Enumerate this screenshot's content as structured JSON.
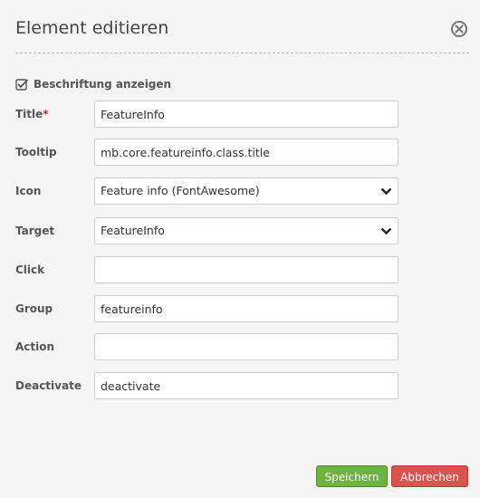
{
  "dialog": {
    "title": "Element editieren",
    "close_icon": "close-circle-icon"
  },
  "show_label": {
    "label": "Beschriftung anzeigen",
    "checked": true
  },
  "fields": {
    "title": {
      "label": "Title",
      "required_mark": "*",
      "value": "FeatureInfo"
    },
    "tooltip": {
      "label": "Tooltip",
      "value": "mb.core.featureinfo.class.title"
    },
    "icon": {
      "label": "Icon",
      "value": "Feature info (FontAwesome)"
    },
    "target": {
      "label": "Target",
      "value": "FeatureInfo"
    },
    "click": {
      "label": "Click",
      "value": ""
    },
    "group": {
      "label": "Group",
      "value": "featureinfo"
    },
    "action": {
      "label": "Action",
      "value": ""
    },
    "deactivate": {
      "label": "Deactivate",
      "value": "deactivate"
    }
  },
  "buttons": {
    "save_label": "Speichern",
    "cancel_label": "Abbrechen"
  },
  "colors": {
    "save": "#6db33f",
    "cancel": "#d9534f",
    "required": "#a83232"
  }
}
